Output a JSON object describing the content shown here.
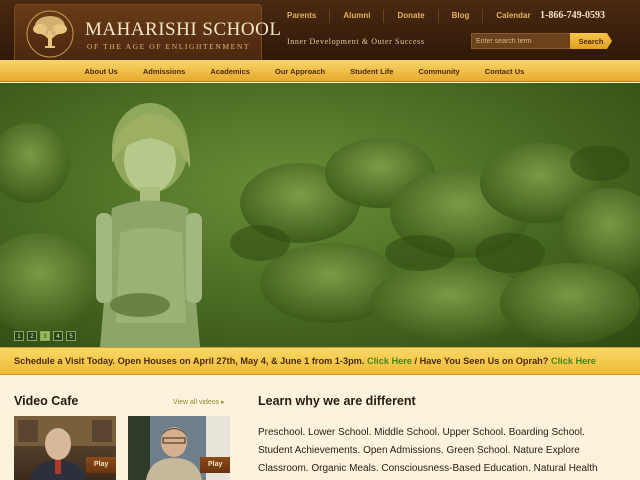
{
  "header": {
    "logo_title": "MAHARISHI SCHOOL",
    "logo_subtitle": "OF THE AGE OF ENLIGHTENMENT",
    "top_links": [
      "Parents",
      "Alumni",
      "Donate",
      "Blog",
      "Calendar"
    ],
    "phone": "1-866-749-0593",
    "tagline": "Inner Development & Outer Success",
    "search": {
      "placeholder": "Enter search term",
      "button_label": "Search"
    }
  },
  "nav": {
    "items": [
      "About Us",
      "Admissions",
      "Academics",
      "Our Approach",
      "Student Life",
      "Community",
      "Contact Us"
    ]
  },
  "hero": {
    "slides": [
      "1",
      "2",
      "3",
      "4",
      "5"
    ],
    "active_slide": "3"
  },
  "announcement": {
    "text": "Schedule a Visit Today. Open Houses on April 27th, May 4, & June 1 from 1-3pm.",
    "link1": "Click Here",
    "separator": " / Have You Seen Us on Oprah? ",
    "link2": "Click Here"
  },
  "video_cafe": {
    "title": "Video Cafe",
    "view_all": "View all videos ▸",
    "play_label": "Play"
  },
  "learn": {
    "title": "Learn why we are different",
    "body": "Preschool. Lower School. Middle School. Upper School. Boarding School. Student Achievements. Open Admissions. Green School. Nature Explore Classroom. Organic Meals. Consciousness-Based Education. Natural Health Programs. Yoga Asanas. Transcendental Meditation. More..."
  },
  "colors": {
    "header_brown": "#3e2110",
    "nav_gold": "#efbf45",
    "link_green": "#3e8a1c"
  }
}
